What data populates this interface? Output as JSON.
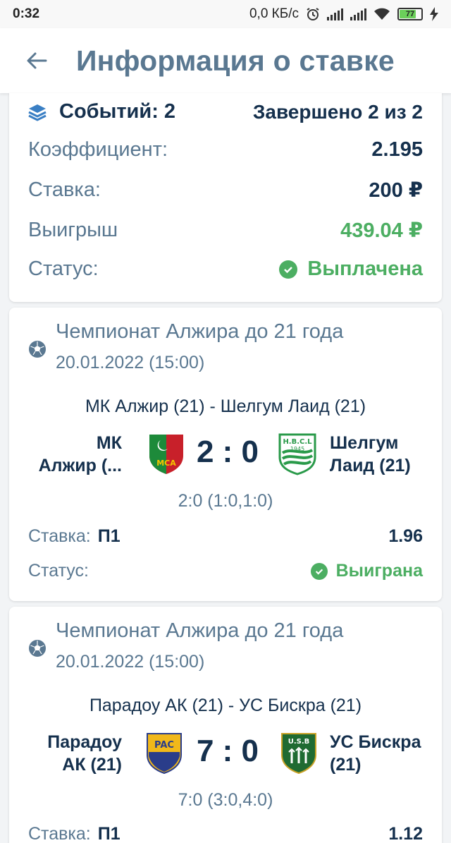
{
  "status_bar": {
    "time": "0:32",
    "network_speed": "0,0 КБ/с",
    "battery": "77"
  },
  "header": {
    "title": "Информация о ставке"
  },
  "summary": {
    "events_label": "Событий: 2",
    "completed": "Завершено 2 из 2",
    "coef_label": "Коэффициент:",
    "coef_value": "2.195",
    "stake_label": "Ставка:",
    "stake_value": "200 ₽",
    "win_label": "Выигрыш",
    "win_value": "439.04 ₽",
    "status_label": "Статус:",
    "status_value": "Выплачена"
  },
  "events": [
    {
      "league": "Чемпионат Алжира до 21 года",
      "date": "20.01.2022 (15:00)",
      "match": "МК Алжир (21) - Шелгум Лаид (21)",
      "home_line1": "МК",
      "home_line2": "Алжир (...",
      "home_logo_text": "MCA",
      "away_line1": "Шелгум",
      "away_line2": "Лаид (21)",
      "away_logo_text": "H.B.C.L",
      "away_logo_year": "1945",
      "score": "2 : 0",
      "subscore": "2:0 (1:0,1:0)",
      "bet_label": "Ставка:",
      "bet_type": "П1",
      "odds": "1.96",
      "status_label": "Статус:",
      "status": "Выиграна"
    },
    {
      "league": "Чемпионат Алжира до 21 года",
      "date": "20.01.2022 (15:00)",
      "match": "Парадоу АК (21) - УС Бискра (21)",
      "home_line1": "Парадоу",
      "home_line2": "АК (21)",
      "home_logo_text": "PAC",
      "away_line1": "УС Бискра",
      "away_line2": "(21)",
      "away_logo_text": "U.S.B",
      "score": "7 : 0",
      "subscore": "7:0 (3:0,4:0)",
      "bet_label": "Ставка:",
      "bet_type": "П1",
      "odds": "1.12"
    }
  ],
  "colors": {
    "title": "#5a7891",
    "text": "#15304d",
    "win": "#4cae62",
    "background": "#f2f4f6"
  }
}
